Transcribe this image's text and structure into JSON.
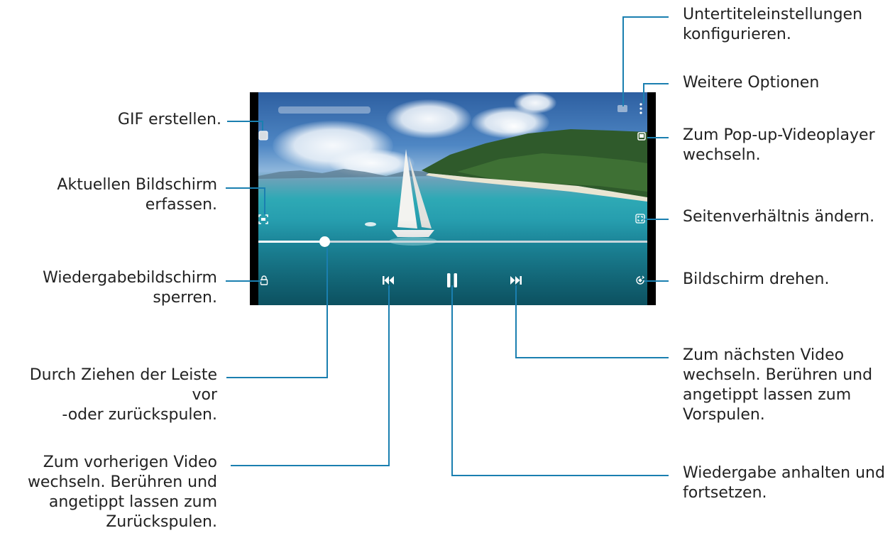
{
  "colors": {
    "leader": "#1a7fb0",
    "text": "#222222",
    "progress_track": "#c8d6dc"
  },
  "player": {
    "progress_fraction": 0.17,
    "icons": [
      "gif-icon",
      "capture-icon",
      "lock-icon",
      "subtitle-icon",
      "more-options-icon",
      "popup-player-icon",
      "aspect-ratio-icon",
      "rotate-icon",
      "previous-icon",
      "pause-icon",
      "next-icon"
    ]
  },
  "callouts": {
    "gif": "GIF erstellen.",
    "capture": "Aktuellen Bildschirm\nerfassen.",
    "lock": "Wiedergabebildschirm\nsperren.",
    "seek": "Durch Ziehen der Leiste vor\n-oder zurückspulen.",
    "previous": "Zum vorherigen Video\nwechseln. Berühren und\nangetippt lassen zum\nZurückspulen.",
    "subtitle": "Untertiteleinstellungen\nkonfigurieren.",
    "more": "Weitere Optionen",
    "popup": "Zum Pop-up-Videoplayer\nwechseln.",
    "aspect": "Seitenverhältnis ändern.",
    "rotate": "Bildschirm drehen.",
    "next": "Zum nächsten Video\nwechseln. Berühren und\nangetippt lassen zum\nVorspulen.",
    "pause": "Wiedergabe anhalten und\nfortsetzen."
  }
}
